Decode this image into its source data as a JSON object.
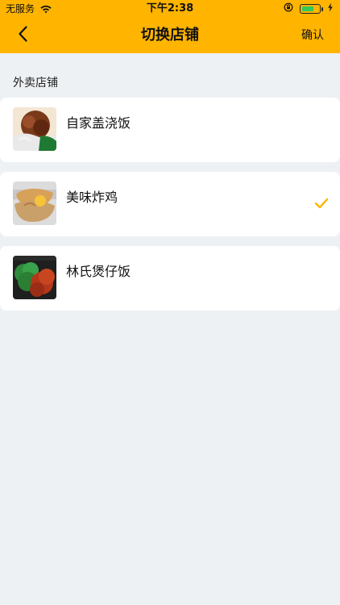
{
  "status_bar": {
    "carrier": "无服务",
    "time": "下午2:38"
  },
  "nav": {
    "title": "切换店铺",
    "confirm_label": "确认"
  },
  "section": {
    "title": "外卖店铺"
  },
  "stores": [
    {
      "name": "自家盖浇饭",
      "selected": false
    },
    {
      "name": "美味炸鸡",
      "selected": true
    },
    {
      "name": "林氏煲仔饭",
      "selected": false
    }
  ],
  "colors": {
    "header_bg": "#ffb400",
    "page_bg": "#eef1f4",
    "accent": "#ffb400"
  },
  "icons": {
    "back": "chevron-left-icon",
    "wifi": "wifi-icon",
    "lock": "rotation-lock-icon",
    "battery": "battery-icon",
    "charging": "bolt-icon",
    "check": "checkmark-icon"
  }
}
